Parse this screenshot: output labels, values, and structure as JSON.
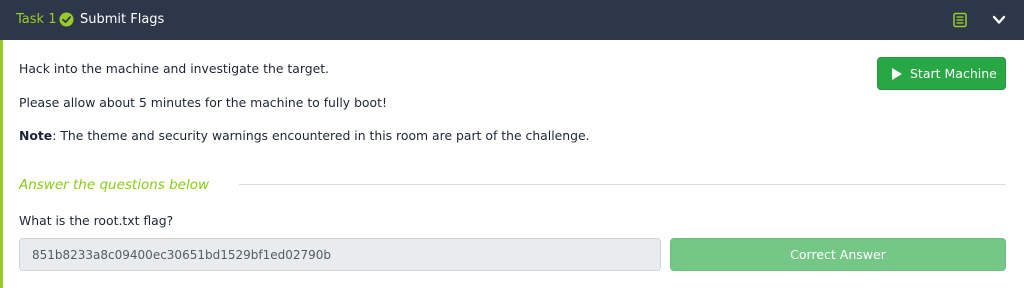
{
  "header": {
    "task_number": "Task 1",
    "title": "Submit Flags",
    "icons": [
      "check-circle-icon",
      "notes-icon",
      "chevron-down-icon"
    ]
  },
  "body": {
    "paragraphs": [
      "Hack into the machine and investigate the target.",
      "Please allow about 5 minutes for the machine to fully boot!"
    ],
    "note": {
      "label": "Note",
      "text": ": The theme and security warnings encountered in this room are part of the challenge."
    },
    "start_button_label": "Start Machine"
  },
  "questions": {
    "heading": "Answer the questions below",
    "items": [
      {
        "question": "What is the root.txt flag?",
        "answer": "851b8233a8c09400ec30651bd1529bf1ed02790b",
        "status_label": "Correct Answer"
      }
    ]
  },
  "colors": {
    "header_bg": "#2e3749",
    "accent_green": "#9acb2a",
    "start_button": "#28a745",
    "correct_button": "#75c786"
  }
}
